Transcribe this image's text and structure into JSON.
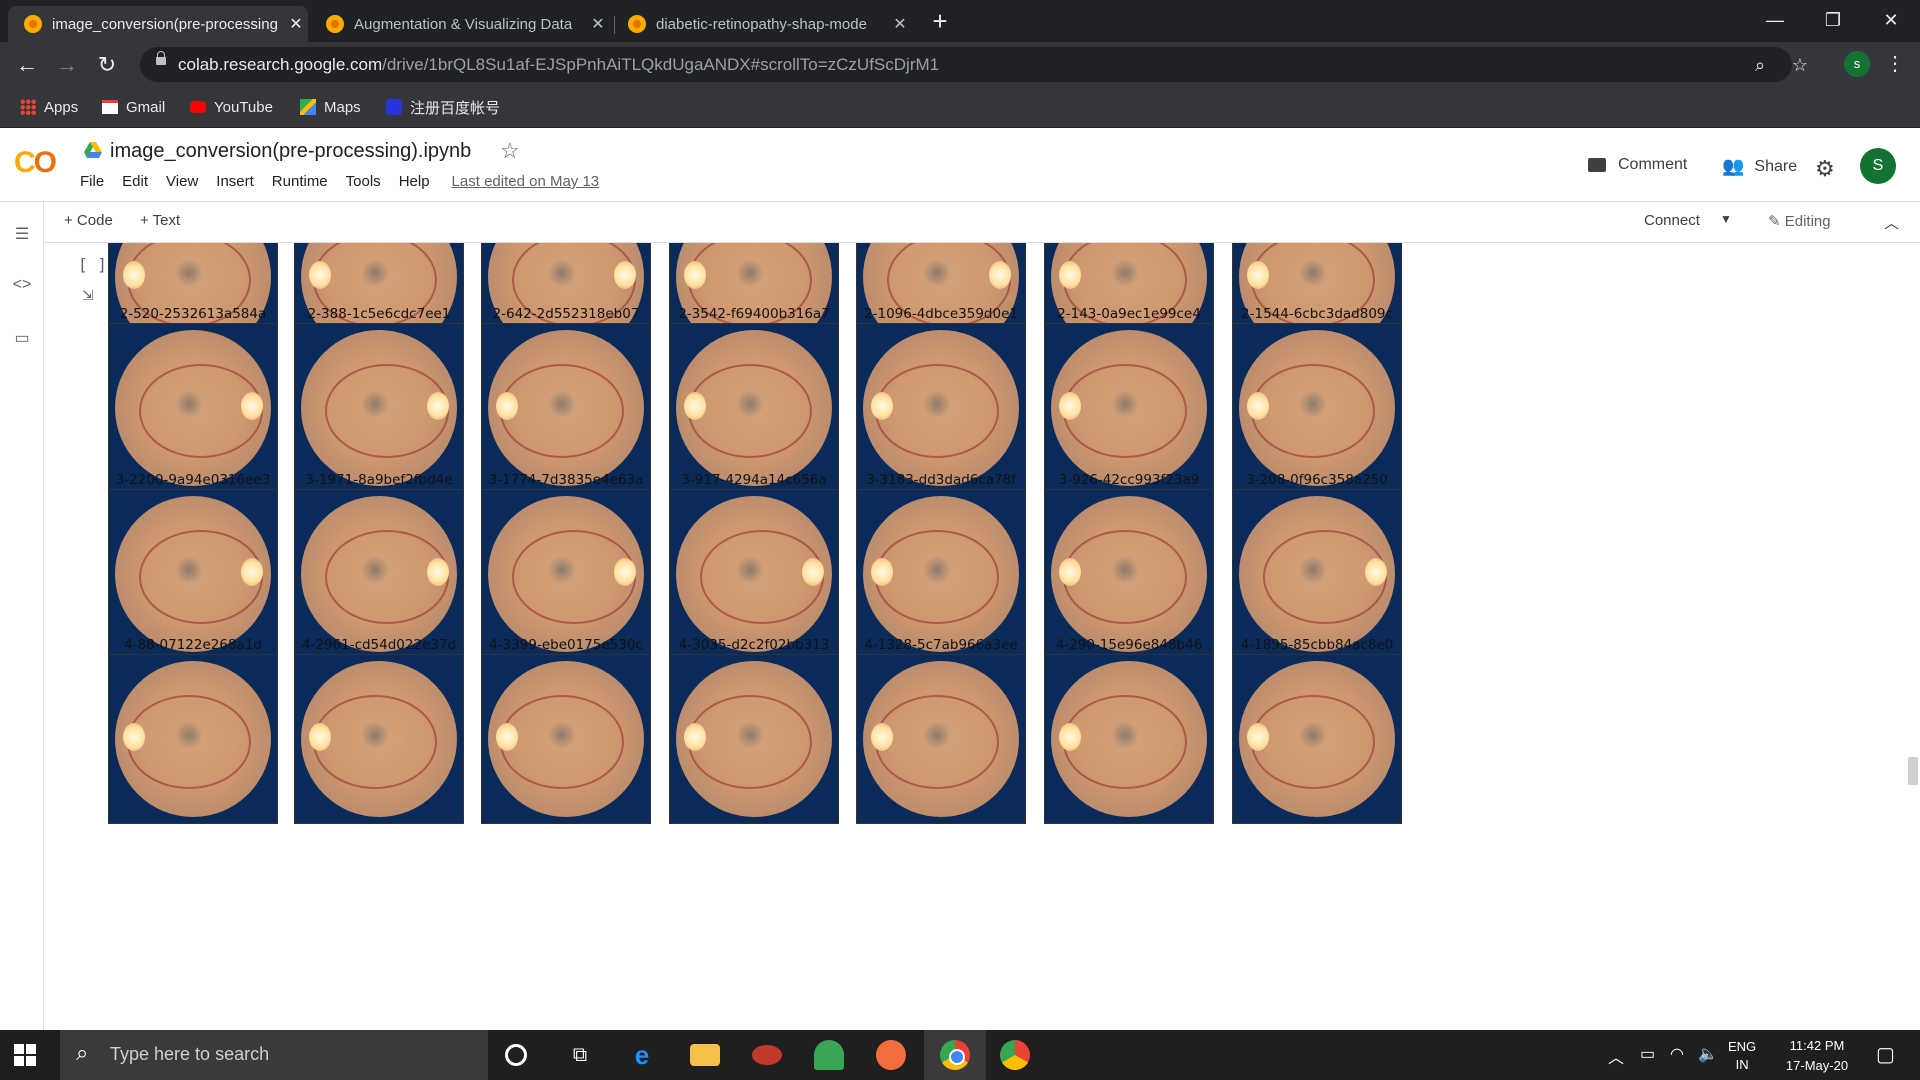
{
  "browser": {
    "tabs": [
      {
        "title": "image_conversion(pre-processing",
        "active": true
      },
      {
        "title": "Augmentation & Visualizing Data",
        "active": false
      },
      {
        "title": "diabetic-retinopathy-shap-mode",
        "active": false
      }
    ],
    "url_host": "colab.research.google.com",
    "url_path": "/drive/1brQL8Su1af-EJSpPnhAiTLQkdUgaANDX#scrollTo=zCzUfScDjrM1",
    "profile_initial": "s",
    "bookmarks": [
      {
        "label": "Apps",
        "icon": "apps-grid-icon"
      },
      {
        "label": "Gmail",
        "icon": "gmail-icon"
      },
      {
        "label": "YouTube",
        "icon": "youtube-icon"
      },
      {
        "label": "Maps",
        "icon": "maps-icon"
      },
      {
        "label": "注册百度帐号",
        "icon": "baidu-icon"
      }
    ]
  },
  "colab": {
    "notebook_title": "image_conversion(pre-processing).ipynb",
    "menu": [
      "File",
      "Edit",
      "View",
      "Insert",
      "Runtime",
      "Tools",
      "Help"
    ],
    "last_edited": "Last edited on May 13",
    "comment_label": "Comment",
    "share_label": "Share",
    "avatar_initial": "S",
    "add_code": "+ Code",
    "add_text": "+ Text",
    "connect_label": "Connect",
    "editing_label": "Editing",
    "cell_bracket": "[ ]"
  },
  "image_grid": {
    "labels": [
      [
        "2-520-2532613a584a",
        "2-388-1c5e6cdc7ee1",
        "2-642-2d552318eb07",
        "2-3542-f69400b316a7",
        "2-1096-4dbce359d0e1",
        "2-143-0a9ec1e99ce4",
        "2-1544-6cbc3dad809c"
      ],
      [
        "3-2200-9a94e0316ee3",
        "3-1971-8a9bef2fbd4e",
        "3-1774-7d3835e4e63a",
        "3-917-4294a14c656a",
        "3-3183-dd3dad6ca78f",
        "3-926-42cc993f23a9",
        "3-208-0f96c358a250"
      ],
      [
        "4-88-07122e268a1d",
        "4-2961-cd54d022e37d",
        "4-3399-ebe0175e530c",
        "4-3035-d2c2f02bb313",
        "4-1328-5c7ab966a3ee",
        "4-290-15e96e848b46",
        "4-1895-85cbb84ac8e0"
      ]
    ]
  },
  "taskbar": {
    "search_placeholder": "Type here to search",
    "lang_top": "ENG",
    "lang_bottom": "IN",
    "time": "11:42 PM",
    "date": "17-May-20"
  }
}
